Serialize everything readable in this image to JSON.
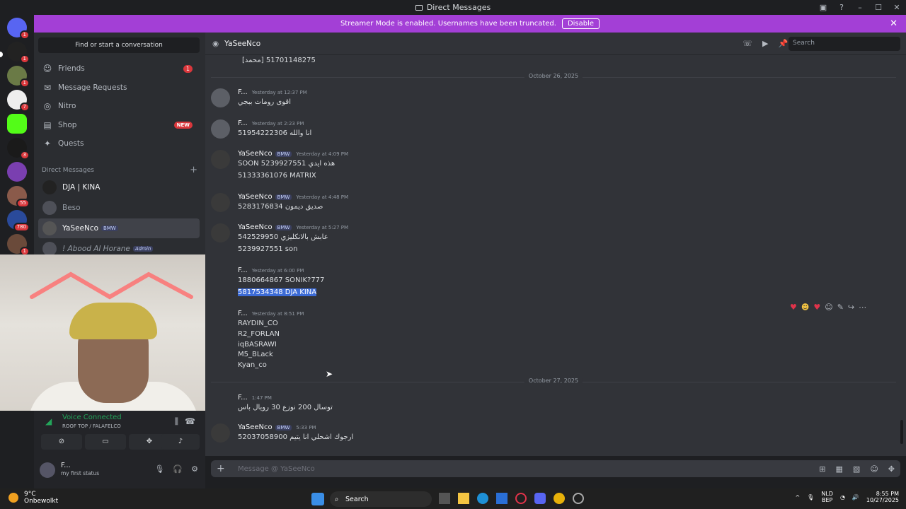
{
  "window": {
    "title": "Direct Messages"
  },
  "streamer": {
    "text": "Streamer Mode is enabled. Usernames have been truncated.",
    "disable": "Disable"
  },
  "guild_badges": [
    "1",
    "1",
    "1",
    "7",
    "3",
    "55",
    "780",
    "1"
  ],
  "sidebar": {
    "find": "Find or start a conversation",
    "nav": [
      {
        "label": "Friends",
        "icon": "friends-icon",
        "badge": "1"
      },
      {
        "label": "Message Requests",
        "icon": "mail-icon"
      },
      {
        "label": "Nitro",
        "icon": "nitro-icon"
      },
      {
        "label": "Shop",
        "icon": "shop-icon",
        "tag": "NEW"
      },
      {
        "label": "Quests",
        "icon": "quests-icon"
      }
    ],
    "dm_header": "Direct Messages",
    "dms": [
      {
        "name": "DJA | KINA"
      },
      {
        "name": "Beso"
      },
      {
        "name": "YaSeeNco",
        "tag": "BMW"
      },
      {
        "name": "! Abood Al Horane",
        "tag": "Admin"
      }
    ]
  },
  "voice": {
    "status": "Voice Connected",
    "channel": "ROOF TOP / FALAFELCO"
  },
  "user": {
    "name": "F...",
    "status": "my first status"
  },
  "chat": {
    "recipient": "YaSeeNco",
    "search_placeholder": "Search",
    "top_line": "[محمد] 51701148275",
    "dates": [
      "October 26, 2025",
      "October 27, 2025"
    ],
    "messages": [
      {
        "author": "F...",
        "time": "Yesterday at 12:37 PM",
        "lines": [
          "اقوى رومات ببجي"
        ]
      },
      {
        "author": "F...",
        "time": "Yesterday at 2:23 PM",
        "lines": [
          "51954222306 انا والله"
        ]
      },
      {
        "author": "YaSeeNco",
        "tag": "BMW",
        "time": "Yesterday at 4:09 PM",
        "lines": [
          "SOON هذه ايدي 5239927551",
          "51333361076 MATRIX"
        ]
      },
      {
        "author": "YaSeeNco",
        "tag": "BMW",
        "time": "Yesterday at 4:48 PM",
        "lines": [
          "5283176834 صديق ديمون"
        ]
      },
      {
        "author": "YaSeeNco",
        "tag": "BMW",
        "time": "Yesterday at 5:27 PM",
        "lines": [
          "542529950 عابش بالانكليزي",
          "5239927551 son"
        ]
      },
      {
        "author": "F...",
        "time": "Yesterday at 6:00 PM",
        "lines": [
          "1880664867 SONIK?777",
          "5817534348 DJA KINA"
        ]
      },
      {
        "author": "F...",
        "time": "Yesterday at 8:51 PM",
        "lines": [
          "RAYDIN_CO",
          "R2_FORLAN",
          "iqBASRAWI",
          "M5_BLack",
          "Kyan_co"
        ]
      },
      {
        "author": "F...",
        "time": "1:47 PM",
        "lines": [
          "توسال 200 نوزع 30 رويال باس"
        ]
      },
      {
        "author": "YaSeeNco",
        "tag": "BMW",
        "time": "5:33 PM",
        "lines": [
          "52037058900 ارجوك اشحلي انا يتيم"
        ]
      }
    ],
    "composer_placeholder": "Message @ YaSeeNco"
  },
  "taskbar": {
    "temp": "9°C",
    "weather": "Onbewolkt",
    "search": "Search",
    "lang": "NLD",
    "layout": "BEP",
    "time": "8:55 PM",
    "date": "10/27/2025"
  },
  "colors": {
    "streamer": "#a33fd6",
    "online": "#23a55a",
    "badge": "#da373c",
    "highlight": "#3c6bd6"
  }
}
